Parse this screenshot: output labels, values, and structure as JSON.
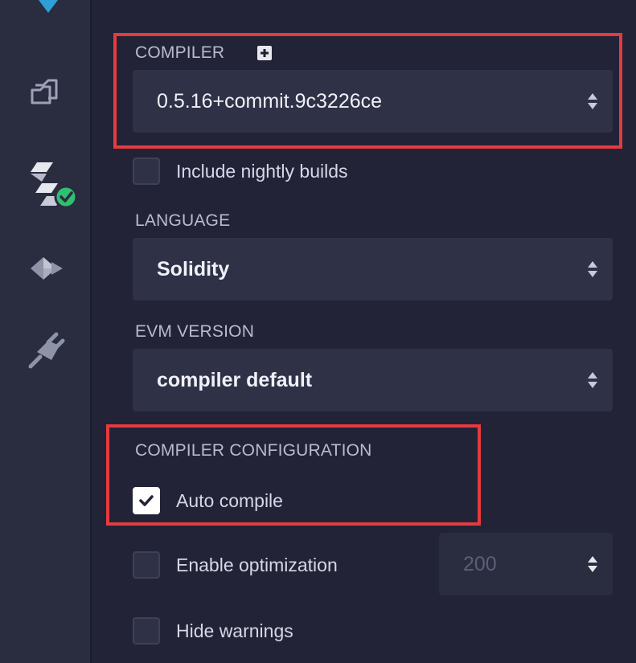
{
  "sidebar": {
    "icons": [
      "logo-icon",
      "file-explorer-icon",
      "solidity-compiler-icon",
      "deploy-run-icon",
      "plugin-manager-icon"
    ]
  },
  "compiler": {
    "label": "COMPILER",
    "version": "0.5.16+commit.9c3226ce"
  },
  "nightly": {
    "label": "Include nightly builds",
    "checked": false
  },
  "language": {
    "label": "LANGUAGE",
    "value": "Solidity"
  },
  "evm": {
    "label": "EVM VERSION",
    "value": "compiler default"
  },
  "configuration": {
    "label": "COMPILER CONFIGURATION",
    "auto_compile": {
      "label": "Auto compile",
      "checked": true
    },
    "optimization": {
      "label": "Enable optimization",
      "checked": false,
      "runs": "200"
    },
    "hide_warnings": {
      "label": "Hide warnings",
      "checked": false
    }
  },
  "colors": {
    "accent": "#e53b3f",
    "success": "#2fbf71",
    "logo": "#2f9fd7"
  }
}
